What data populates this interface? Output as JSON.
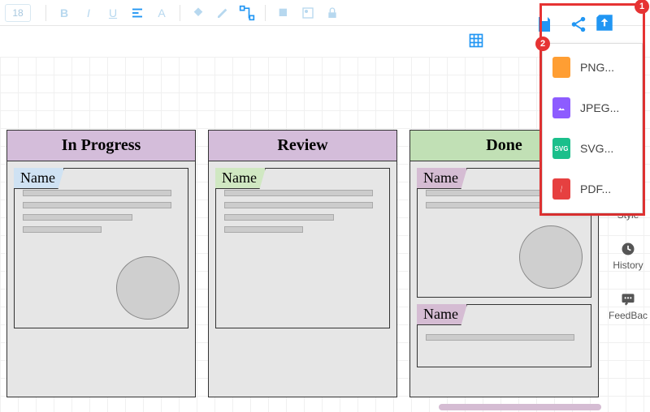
{
  "toolbar": {
    "font_size": "18",
    "bold": "B",
    "italic": "I",
    "underline": "U",
    "align_icon": "align-icon",
    "font_color": "A",
    "fill_icon": "fill-icon",
    "pencil_icon": "pencil-icon",
    "connector_icon": "connector-icon",
    "shadow_icon": "shadow-icon",
    "image_icon": "image-icon",
    "lock_icon": "lock-icon"
  },
  "actions": {
    "save_icon": "save-icon",
    "share_icon": "share-icon",
    "export_icon": "export-icon",
    "grid_icon": "grid-icon"
  },
  "annotations": {
    "badge1": "1",
    "badge2": "2"
  },
  "export_menu": {
    "items": [
      {
        "label": "PNG...",
        "icon_color": "#ff9e33",
        "icon_text": ""
      },
      {
        "label": "JPEG...",
        "icon_color": "#8d5cff",
        "icon_text": ""
      },
      {
        "label": "SVG...",
        "icon_color": "#1bbf8b",
        "icon_text": "SVG"
      },
      {
        "label": "PDF...",
        "icon_color": "#e64040",
        "icon_text": ""
      }
    ]
  },
  "boards": [
    {
      "title": "In Progress",
      "header_color": "h-purple",
      "cards": [
        {
          "tab": "Name",
          "tab_color": "tab-blue",
          "lines": [
            "w1",
            "w2",
            "w3",
            "w4"
          ],
          "circle": true,
          "size": "tall"
        }
      ]
    },
    {
      "title": "Review",
      "header_color": "h-purple",
      "cards": [
        {
          "tab": "Name",
          "tab_color": "tab-green",
          "lines": [
            "w1",
            "w2",
            "w3",
            "w4"
          ],
          "circle": false,
          "size": "tall"
        }
      ]
    },
    {
      "title": "Done",
      "header_color": "h-green",
      "cards": [
        {
          "tab": "Name",
          "tab_color": "tab-mauve",
          "lines": [
            "w1",
            "w2"
          ],
          "circle": true,
          "size": "tall-short"
        },
        {
          "tab": "Name",
          "tab_color": "tab-mauve",
          "lines": [
            "w1"
          ],
          "circle": false,
          "size": "short"
        }
      ]
    }
  ],
  "sidebar": {
    "items": [
      {
        "label": "Style",
        "icon": "style-icon"
      },
      {
        "label": "History",
        "icon": "history-icon"
      },
      {
        "label": "FeedBac",
        "icon": "feedback-icon"
      }
    ]
  }
}
